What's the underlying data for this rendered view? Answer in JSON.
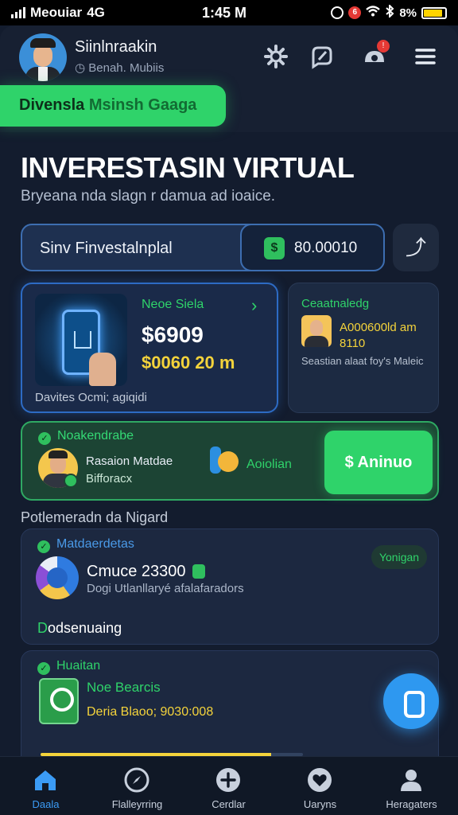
{
  "status_bar": {
    "carrier": "Meouiar",
    "network": "4G",
    "time": "1:45 M",
    "badge": "6",
    "battery": "8%"
  },
  "header": {
    "user_name": "Siinlnraakin",
    "user_sub": "Benah. Mubiis",
    "icons": [
      "settings-icon",
      "edit-icon",
      "notifications-icon",
      "menu-icon"
    ]
  },
  "promo": {
    "text_a": "Divensla ",
    "text_b": "Msinsh Gaaga"
  },
  "page": {
    "title": "INVERESTASIN VIRTUAL",
    "subtitle": "Bryeana nda slagn r damua ad ioaice."
  },
  "search": {
    "label": "Sinv Finvestalnplal",
    "balance": "80.00010",
    "filter_icon": "filter-icon"
  },
  "main_card": {
    "tag": "Neoe Siela",
    "value": "$6909",
    "value2": "$0060 20 m",
    "footer": "Davites Ocmi; agiqidi"
  },
  "side_card": {
    "title": "Ceaatnaledg",
    "value": "A000600ld am 8110",
    "note": "Seastian alaat foy's Maleic"
  },
  "green_card": {
    "title": "Noakendrabe",
    "text_line1": "Rasaion Matdae",
    "text_line2": "Bifforacx",
    "action_label": "Aoiolian",
    "button": "Aninuo"
  },
  "section_title": "Potlemeradn da Nigard",
  "list_card_1": {
    "tag": "Matdaerdetas",
    "pill": "Yonigan",
    "title": "Cmuce 23300",
    "subtitle": "Dogi Utlanllaryé afalafaradors",
    "footer_a": "D",
    "footer_b": "odsenuaing"
  },
  "list_card_2": {
    "tag": "Huaitan",
    "title": "Noe Bearcis",
    "subtitle": "Deria Blaoo; 9030:008",
    "progress": 0.88
  },
  "bottom_nav": [
    {
      "label": "Daala",
      "icon": "home-icon",
      "active": true
    },
    {
      "label": "Flalleyrring",
      "icon": "compass-icon",
      "active": false
    },
    {
      "label": "Cerdlar",
      "icon": "add-icon",
      "active": false
    },
    {
      "label": "Uaryns",
      "icon": "heart-icon",
      "active": false
    },
    {
      "label": "Heragaters",
      "icon": "profile-icon",
      "active": false
    }
  ],
  "colors": {
    "accent_green": "#2fd36a",
    "accent_blue": "#2e98f0",
    "accent_yellow": "#f4d33b",
    "background": "#131c2e"
  }
}
